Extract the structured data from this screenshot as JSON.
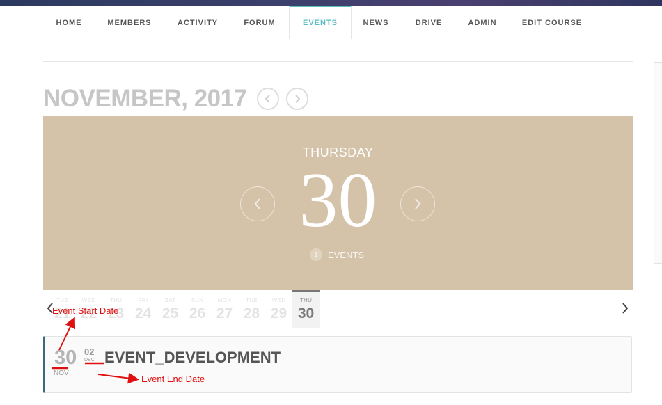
{
  "nav": {
    "items": [
      {
        "label": "HOME"
      },
      {
        "label": "MEMBERS"
      },
      {
        "label": "ACTIVITY"
      },
      {
        "label": "FORUM"
      },
      {
        "label": "EVENTS",
        "active": true
      },
      {
        "label": "NEWS"
      },
      {
        "label": "DRIVE"
      },
      {
        "label": "ADMIN"
      },
      {
        "label": "EDIT COURSE"
      }
    ],
    "active_color": "#5bbcc2"
  },
  "calendar": {
    "month_title": "NOVEMBER, 2017",
    "hero": {
      "weekday": "THURSDAY",
      "day": "30",
      "event_count": "1",
      "events_label": "EVENTS",
      "background": "#d4c3a9"
    },
    "week": [
      {
        "dn": "TUE",
        "dd": "21"
      },
      {
        "dn": "WED",
        "dd": "22"
      },
      {
        "dn": "THU",
        "dd": "23"
      },
      {
        "dn": "FRI",
        "dd": "24"
      },
      {
        "dn": "SAT",
        "dd": "25"
      },
      {
        "dn": "SUN",
        "dd": "26"
      },
      {
        "dn": "MON",
        "dd": "27"
      },
      {
        "dn": "TUE",
        "dd": "28"
      },
      {
        "dn": "WED",
        "dd": "29"
      },
      {
        "dn": "THU",
        "dd": "30",
        "active": true
      }
    ]
  },
  "event": {
    "start_day": "30",
    "start_month": "NOV",
    "end_day": "02",
    "end_month": "DEC",
    "title": "EVENT_DEVELOPMENT"
  },
  "annotations": {
    "start_label": "Event Start Date",
    "end_label": "Event End Date",
    "color": "#e01010"
  }
}
